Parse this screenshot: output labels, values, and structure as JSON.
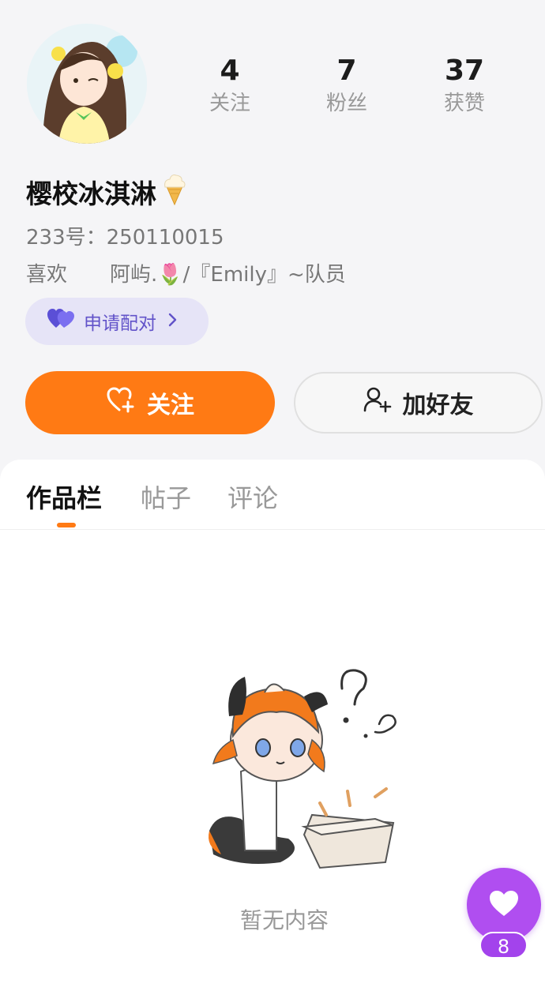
{
  "profile": {
    "name": "樱校冰淇淋",
    "name_emoji_icon": "ice-cream-icon",
    "uid_text": "233号：250110015",
    "likes_label": "喜欢",
    "likes_target": "阿屿.🌷/『Emily』~队员"
  },
  "stats": [
    {
      "value": "4",
      "label": "关注"
    },
    {
      "value": "7",
      "label": "粉丝"
    },
    {
      "value": "37",
      "label": "获赞"
    }
  ],
  "pair_button": {
    "label": "申请配对",
    "icon": "double-heart-icon"
  },
  "actions": {
    "follow_label": "关注",
    "add_friend_label": "加好友"
  },
  "tabs": [
    {
      "label": "作品栏",
      "active": true
    },
    {
      "label": "帖子",
      "active": false
    },
    {
      "label": "评论",
      "active": false
    }
  ],
  "empty_state": {
    "text": "暂无内容"
  },
  "floating": {
    "badge_count": "8",
    "icon": "heart-icon"
  },
  "colors": {
    "accent": "#ff7a14",
    "purple": "#b04ef0",
    "pair_text": "#6253c9"
  }
}
